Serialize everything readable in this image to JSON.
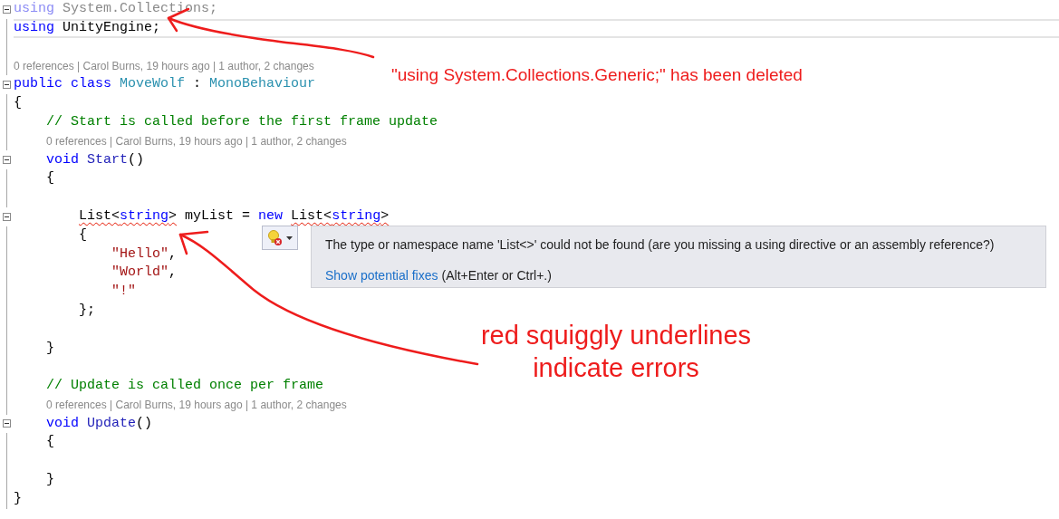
{
  "editor": {
    "lines": [
      {
        "kind": "code",
        "fold": true,
        "current": false,
        "tokens": [
          {
            "text": "using ",
            "kind": "keyword",
            "faded": true
          },
          {
            "text": "System.Collections;",
            "kind": "plain",
            "faded": true
          }
        ]
      },
      {
        "kind": "code",
        "fold": false,
        "current": true,
        "tokens": [
          {
            "text": "using ",
            "kind": "keyword"
          },
          {
            "text": "UnityEngine;",
            "kind": "plain"
          }
        ]
      },
      {
        "kind": "blank"
      },
      {
        "kind": "lens",
        "text": "0 references | Carol Burns, 19 hours ago | 1 author, 2 changes"
      },
      {
        "kind": "code",
        "fold": true,
        "current": false,
        "tokens": [
          {
            "text": "public class ",
            "kind": "keyword"
          },
          {
            "text": "MoveWolf",
            "kind": "type"
          },
          {
            "text": " : ",
            "kind": "plain"
          },
          {
            "text": "MonoBehaviour",
            "kind": "type"
          }
        ]
      },
      {
        "kind": "code",
        "fold": false,
        "current": false,
        "tokens": [
          {
            "text": "{",
            "kind": "plain"
          }
        ]
      },
      {
        "kind": "code",
        "fold": false,
        "current": false,
        "tokens": [
          {
            "text": "    // Start is called before the first frame update",
            "kind": "comment"
          }
        ]
      },
      {
        "kind": "lens",
        "text": "    0 references | Carol Burns, 19 hours ago | 1 author, 2 changes"
      },
      {
        "kind": "code",
        "fold": true,
        "current": false,
        "tokens": [
          {
            "text": "    void ",
            "kind": "keyword"
          },
          {
            "text": "Start",
            "kind": "method"
          },
          {
            "text": "()",
            "kind": "plain"
          }
        ]
      },
      {
        "kind": "code",
        "fold": false,
        "current": false,
        "tokens": [
          {
            "text": "    {",
            "kind": "plain"
          }
        ]
      },
      {
        "kind": "blank"
      },
      {
        "kind": "code",
        "fold": true,
        "current": false,
        "tokens": [
          {
            "text": "        List<",
            "kind": "plain",
            "error": true
          },
          {
            "text": "string",
            "kind": "keyword",
            "error": true
          },
          {
            "text": ">",
            "kind": "plain",
            "error": true
          },
          {
            "text": " myList = ",
            "kind": "plain"
          },
          {
            "text": "new ",
            "kind": "keyword"
          },
          {
            "text": "List<",
            "kind": "plain",
            "error": true
          },
          {
            "text": "string",
            "kind": "keyword",
            "error": true
          },
          {
            "text": ">",
            "kind": "plain",
            "error": true
          }
        ]
      },
      {
        "kind": "code",
        "fold": false,
        "current": false,
        "tokens": [
          {
            "text": "        {",
            "kind": "plain"
          }
        ]
      },
      {
        "kind": "code",
        "fold": false,
        "current": false,
        "tokens": [
          {
            "text": "            \"Hello\"",
            "kind": "string"
          },
          {
            "text": ",",
            "kind": "plain"
          }
        ]
      },
      {
        "kind": "code",
        "fold": false,
        "current": false,
        "tokens": [
          {
            "text": "            \"World\"",
            "kind": "string"
          },
          {
            "text": ",",
            "kind": "plain"
          }
        ]
      },
      {
        "kind": "code",
        "fold": false,
        "current": false,
        "tokens": [
          {
            "text": "            \"!\"",
            "kind": "string"
          }
        ]
      },
      {
        "kind": "code",
        "fold": false,
        "current": false,
        "tokens": [
          {
            "text": "        };",
            "kind": "plain"
          }
        ]
      },
      {
        "kind": "blank"
      },
      {
        "kind": "code",
        "fold": false,
        "current": false,
        "tokens": [
          {
            "text": "    }",
            "kind": "plain"
          }
        ]
      },
      {
        "kind": "blank"
      },
      {
        "kind": "code",
        "fold": false,
        "current": false,
        "tokens": [
          {
            "text": "    // Update is called once per frame",
            "kind": "comment"
          }
        ]
      },
      {
        "kind": "lens",
        "text": "    0 references | Carol Burns, 19 hours ago | 1 author, 2 changes"
      },
      {
        "kind": "code",
        "fold": true,
        "current": false,
        "tokens": [
          {
            "text": "    void ",
            "kind": "keyword"
          },
          {
            "text": "Update",
            "kind": "method"
          },
          {
            "text": "()",
            "kind": "plain"
          }
        ]
      },
      {
        "kind": "code",
        "fold": false,
        "current": false,
        "tokens": [
          {
            "text": "    {",
            "kind": "plain"
          }
        ]
      },
      {
        "kind": "blank"
      },
      {
        "kind": "code",
        "fold": false,
        "current": false,
        "tokens": [
          {
            "text": "    }",
            "kind": "plain"
          }
        ]
      },
      {
        "kind": "code",
        "fold": false,
        "current": false,
        "tokens": [
          {
            "text": "}",
            "kind": "plain"
          }
        ]
      }
    ]
  },
  "quick_action": {
    "message": "The type or namespace name 'List<>' could not be found (are you missing a using directive or an assembly reference?)",
    "link": "Show potential fixes",
    "shortcut": "(Alt+Enter or Ctrl+.)"
  },
  "annotations": [
    {
      "text": "\"using System.Collections.Generic;\" has been deleted"
    },
    {
      "text": "red squiggly underlines"
    },
    {
      "text": "indicate errors"
    }
  ]
}
